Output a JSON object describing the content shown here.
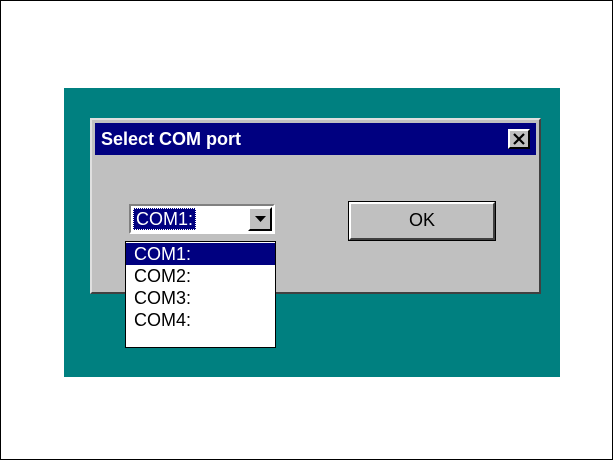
{
  "dialog": {
    "title": "Select COM port",
    "close_icon": "close-x-icon",
    "ok_label": "OK"
  },
  "combo": {
    "selected_value": "COM1:",
    "arrow_icon": "dropdown-arrow-icon"
  },
  "dropdown": {
    "options": [
      "COM1:",
      "COM2:",
      "COM3:",
      "COM4:"
    ],
    "selected_index": 0
  },
  "colors": {
    "desktop": "#008080",
    "titlebar": "#000080",
    "dialog_face": "#c0c0c0",
    "highlight": "#000080"
  }
}
